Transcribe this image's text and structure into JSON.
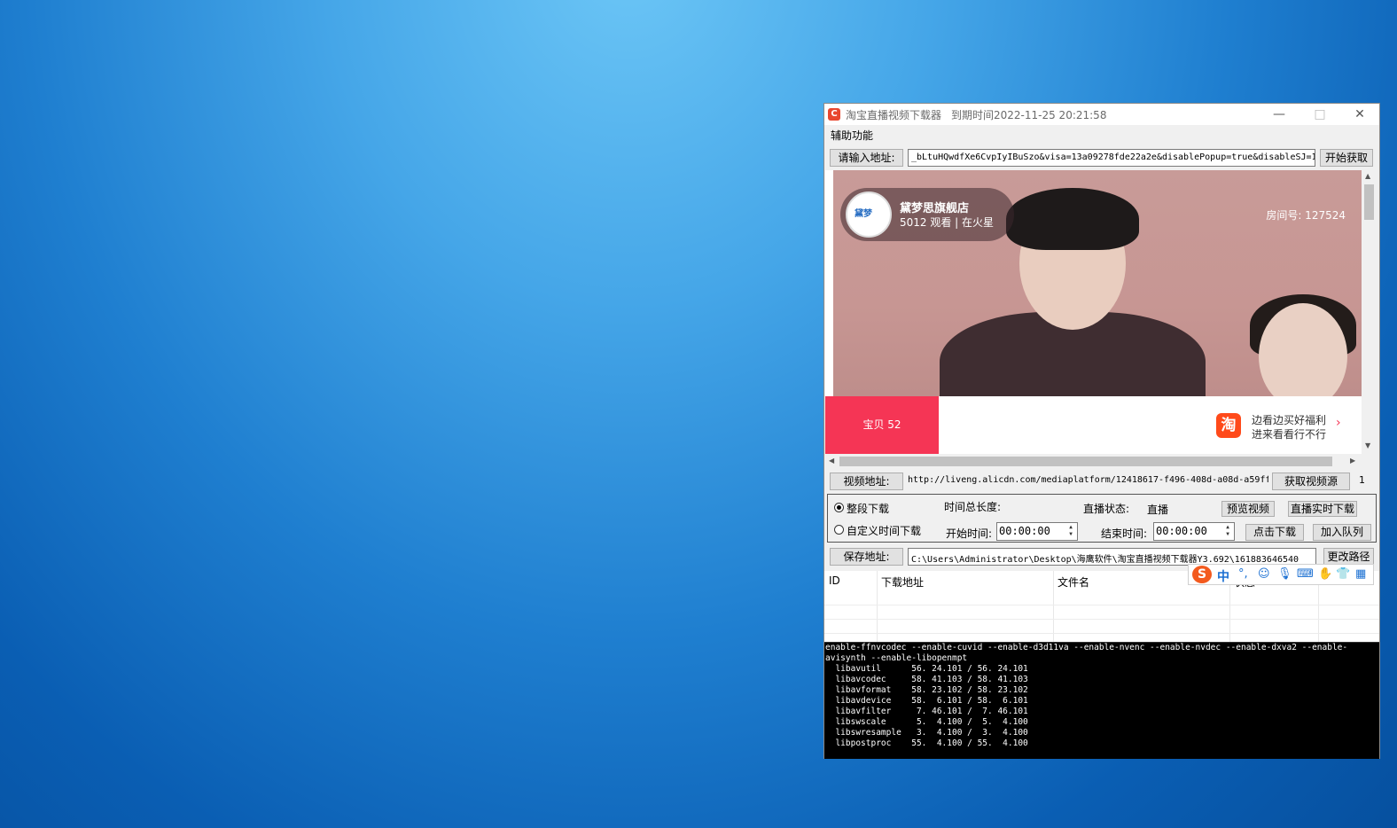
{
  "window": {
    "title": "淘宝直播视频下载器",
    "expire": "到期时间2022-11-25 20:21:58",
    "app_icon": "C"
  },
  "controls": {
    "minimize": "—",
    "maximize": "□",
    "close": "✕"
  },
  "menu": {
    "items": [
      "辅助功能"
    ]
  },
  "url_row": {
    "label": "请输入地址:",
    "value": "_bLtuHQwdfXe6CvpIyIBuSzo&visa=13a09278fde22a2e&disablePopup=true&disableSJ=1",
    "button": "开始获取"
  },
  "preview": {
    "host_name": "黛梦思旗舰店",
    "host_viewers": "5012 观看 | 在火星",
    "avatar_text": "黛梦",
    "room_no": "房间号: 127524",
    "baby_button": "宝贝 52",
    "tao_icon": "淘",
    "promo_line1": "边看边买好福利",
    "promo_line2": "进来看看行不行",
    "promo_arrow": "›"
  },
  "video_row": {
    "label": "视频地址:",
    "value": "http://liveng.alicdn.com/mediaplatform/12418617-f496-408d-a08d-a59ff",
    "button": "获取视频源",
    "count": "1"
  },
  "options": {
    "radio_full": "整段下载",
    "radio_custom": "自定义时间下载",
    "total_length_label": "时间总长度:",
    "status_label": "直播状态:",
    "status_value": "直播",
    "preview_button": "预览视频",
    "realtime_button": "直播实时下载",
    "start_label": "开始时间:",
    "start_value": "00:00:00",
    "end_label": "结束时间:",
    "end_value": "00:00:00",
    "download_button": "点击下载",
    "queue_button": "加入队列"
  },
  "save_row": {
    "label": "保存地址:",
    "value": "C:\\Users\\Administrator\\Desktop\\海鹰软件\\淘宝直播视频下载器Y3.692\\161883646540",
    "button": "更改路径"
  },
  "ime": {
    "logo": "S",
    "mode": "中",
    "icons": [
      "°,",
      "☺",
      "🎙",
      "⌨",
      "✋",
      "👕",
      "▦"
    ]
  },
  "table": {
    "columns": [
      "ID",
      "下载地址",
      "文件名",
      "状态"
    ]
  },
  "console": {
    "lines": [
      "enable-ffnvcodec --enable-cuvid --enable-d3d11va --enable-nvenc --enable-nvdec --enable-dxva2 --enable-",
      "avisynth --enable-libopenmpt",
      "  libavutil      56. 24.101 / 56. 24.101",
      "  libavcodec     58. 41.103 / 58. 41.103",
      "  libavformat    58. 23.102 / 58. 23.102",
      "  libavdevice    58.  6.101 / 58.  6.101",
      "  libavfilter     7. 46.101 /  7. 46.101",
      "  libswscale      5.  4.100 /  5.  4.100",
      "  libswresample   3.  4.100 /  3.  4.100",
      "  libpostproc    55.  4.100 / 55.  4.100"
    ]
  },
  "colors": {
    "accent_red": "#f53555",
    "tao_orange": "#ff4a1a",
    "ime_blue": "#1a6fd2"
  }
}
